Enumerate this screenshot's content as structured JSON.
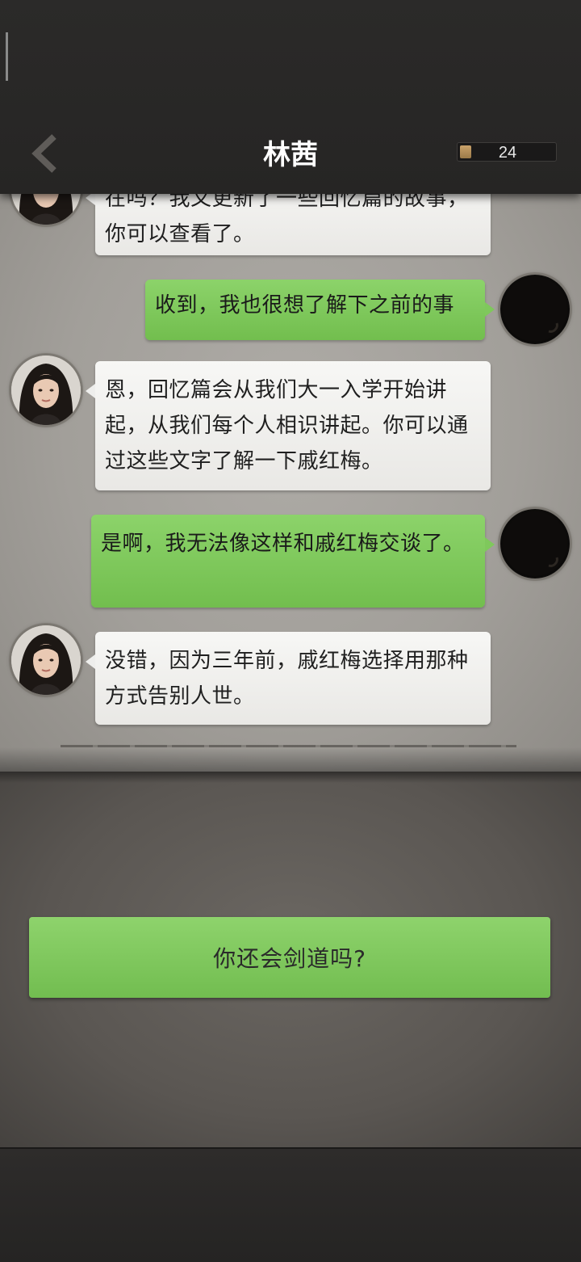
{
  "header": {
    "title": "林茜",
    "counter_value": "24",
    "counter_level": 0.12
  },
  "messages": [
    {
      "from": "in",
      "text": "在吗？我又更新了一些回忆篇的故事，你可以查看了。"
    },
    {
      "from": "out",
      "text": "收到，我也很想了解下之前的事"
    },
    {
      "from": "in",
      "text": "恩，回忆篇会从我们大一入学开始讲起，从我们每个人相识讲起。你可以通过这些文字了解一下戚红梅。"
    },
    {
      "from": "out",
      "text": "是啊，我无法像这样和戚红梅交谈了。"
    },
    {
      "from": "in",
      "text": "没错，因为三年前，戚红梅选择用那种方式告别人世。"
    }
  ],
  "choice": {
    "label": "你还会剑道吗?"
  },
  "colors": {
    "bubble_out": "#7fc85c",
    "bubble_in": "#f2f2f0",
    "choice": "#80c85e"
  }
}
